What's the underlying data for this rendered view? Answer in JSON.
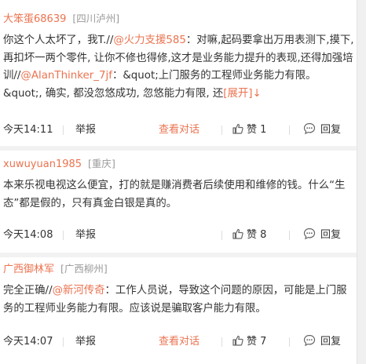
{
  "comments": [
    {
      "user": "大笨蛋68639",
      "location": "四川泸州",
      "text1": "你这个人太坏了，我T.//",
      "mention1": "@火力支援585",
      "text2": "：对嘛,起码要拿出万用表测下,摸下,再扣坏一两个零件, 让你不修也得修,这才是业务能力提升的表现,还得加强培训//",
      "mention2": "@AlanThinker_7jf",
      "text3": "：&quot;上门服务的工程师业务能力有限。&quot;, 确实, 都没忽悠成功, 忽悠能力有限, 还",
      "expand": "[展开]↓",
      "time": "今天14:11",
      "report": "举报",
      "dialog": "查看对话",
      "likes": "赞 1",
      "reply": "回复"
    },
    {
      "user": "xuwuyuan1985",
      "location": "重庆",
      "text": "本来乐视电视这么便宜，打的就是赚消费者后续使用和维修的钱。什么“生态”都是假的，只有真金白银是真的。",
      "time": "今天14:08",
      "report": "举报",
      "likes": "赞 8",
      "reply": "回复"
    },
    {
      "user": "广西御林军",
      "location": "广西柳州",
      "text1": "完全正确//",
      "mention1": "@新河传奇",
      "text2": "：工作人员说，导致这个问题的原因，可能是上门服务的工程师业务能力有限。应该说是骗取客户能力有限。",
      "time": "今天14:07",
      "report": "举报",
      "dialog": "查看对话",
      "likes": "赞 7",
      "reply": "回复"
    }
  ],
  "colors": {
    "accent": "#eb7350",
    "meta": "#999999",
    "text": "#333333",
    "separator": "#f2f2f2"
  },
  "icons": {
    "like": "thumbs-up-icon",
    "reply": "chat-bubble-icon"
  }
}
